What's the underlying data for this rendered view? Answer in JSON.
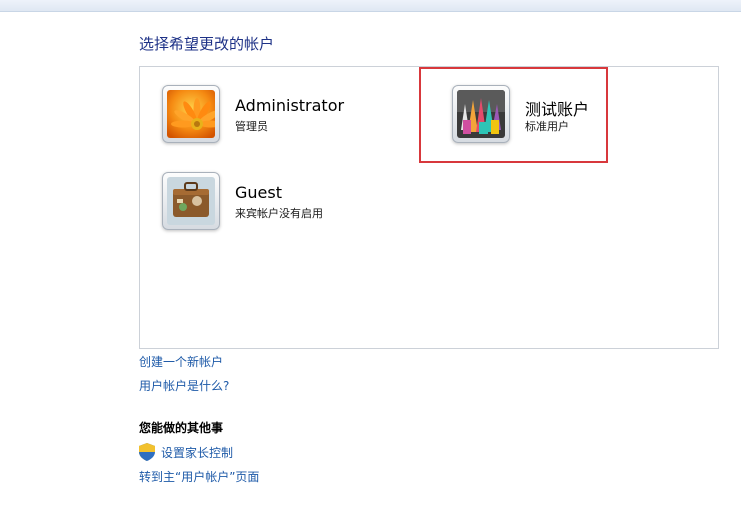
{
  "header": {
    "title": "选择希望更改的帐户"
  },
  "accounts": [
    {
      "name": "Administrator",
      "type": "管理员",
      "avatar_icon": "flower-avatar-icon"
    },
    {
      "name": "测试账户",
      "type": "标准用户",
      "avatar_icon": "crayons-avatar-icon"
    },
    {
      "name": "Guest",
      "type": "来宾帐户没有启用",
      "avatar_icon": "suitcase-avatar-icon"
    }
  ],
  "links": {
    "create_account": "创建一个新帐户",
    "what_is_account": "用户帐户是什么?"
  },
  "other_tasks": {
    "heading": "您能做的其他事",
    "parental_controls": "设置家长控制",
    "parental_controls_icon": "shield-icon",
    "go_to_main": "转到主“用户帐户”页面"
  },
  "colors": {
    "title": "#1e3287",
    "link": "#1e5aa8",
    "highlight": "#d8383c"
  }
}
